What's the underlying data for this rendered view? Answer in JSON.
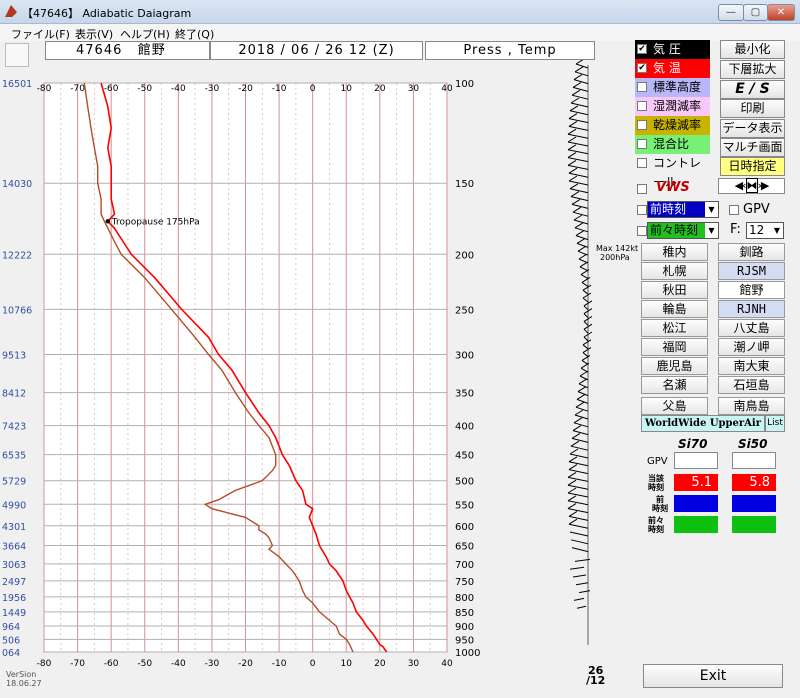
{
  "window": {
    "title": "【47646】 Adiabatic Daiagram",
    "min": "—",
    "max": "▢",
    "close": "✕"
  },
  "menu": [
    "ファイル(F)",
    "表示(V)",
    "ヘルプ(H)",
    "終了(Q)"
  ],
  "header": {
    "station_no": "47646",
    "station_name": "館野",
    "datetime": "2018 / 06 / 26  12 (Z)",
    "mode": "Press , Temp"
  },
  "checks": [
    {
      "label": "気 圧",
      "checked": true,
      "color": "#000000",
      "text": "#ffffff"
    },
    {
      "label": "気 温",
      "checked": true,
      "color": "#ff0000",
      "text": "#ffffff"
    },
    {
      "label": "標準高度",
      "checked": false,
      "color": "#b8b8f8",
      "text": "#000000"
    },
    {
      "label": "湿潤減率",
      "checked": false,
      "color": "#f8c8f8",
      "text": "#000000"
    },
    {
      "label": "乾燥減率",
      "checked": false,
      "color": "#c8b400",
      "text": "#000000"
    },
    {
      "label": "混合比",
      "checked": false,
      "color": "#78f078",
      "text": "#000000"
    },
    {
      "label": "コントレール",
      "checked": false,
      "color": "#f0f0f0",
      "text": "#000000"
    }
  ],
  "buttons": {
    "minimize": "最小化",
    "lower_zoom": "下層拡大",
    "es": "E / S",
    "print": "印刷",
    "data": "データ表示",
    "multi": "マルチ画面",
    "time": "日時指定"
  },
  "vws": "VWS",
  "prev": "前時刻",
  "prev2": "前々時刻",
  "gpv": "GPV",
  "f_label": "F:",
  "f_value": "12",
  "stations": [
    [
      "稚内",
      "釧路"
    ],
    [
      "札幌",
      "RJSM"
    ],
    [
      "秋田",
      "館野"
    ],
    [
      "輪島",
      "RJNH"
    ],
    [
      "松江",
      "八丈島"
    ],
    [
      "福岡",
      "潮ノ岬"
    ],
    [
      "鹿児島",
      "南大東"
    ],
    [
      "名瀬",
      "石垣島"
    ],
    [
      "父島",
      "南鳥島"
    ]
  ],
  "worldwide": "WorldWide UpperAir",
  "list": "List",
  "si": {
    "h70": "Si70",
    "h50": "Si50",
    "gpv": "GPV",
    "cur": "当該\n時刻",
    "cur_a": "当該",
    "cur_b": "時刻",
    "prev_a": "前",
    "prev_b": "時刻",
    "prev2_a": "前々",
    "prev2_b": "時刻",
    "v70": "5.1",
    "v50": "5.8"
  },
  "exit": "Exit",
  "version": {
    "a": "VerSion",
    "b": "18.06.27"
  },
  "barb_note": {
    "a": "Max 142kt",
    "b": "200hPa"
  },
  "barb_time": {
    "a": "26",
    "b": "/12"
  },
  "chart_data": {
    "type": "line",
    "title": "",
    "x_ticks": [
      -80,
      -70,
      -60,
      -50,
      -40,
      -30,
      -20,
      -10,
      0,
      10,
      20,
      30,
      40
    ],
    "xlim": [
      -80,
      40
    ],
    "pressure_ticks": [
      100,
      150,
      200,
      250,
      300,
      350,
      400,
      450,
      500,
      550,
      600,
      650,
      700,
      750,
      800,
      850,
      900,
      950,
      1000
    ],
    "height_ticks": [
      "16501",
      "14030",
      "12222",
      "10766",
      "9513",
      "8412",
      "7423",
      "6535",
      "5729",
      "4990",
      "4301",
      "3664",
      "3063",
      "2497",
      "1956",
      "1449",
      "964",
      "506",
      "064"
    ],
    "annotation": "Tropopause 175hPa",
    "annotation_point": {
      "p": 175,
      "t": -61
    },
    "series": [
      {
        "color": "#ff0000",
        "values": [
          [
            100,
            -63
          ],
          [
            110,
            -61
          ],
          [
            120,
            -60
          ],
          [
            130,
            -61
          ],
          [
            140,
            -60
          ],
          [
            150,
            -60
          ],
          [
            160,
            -60
          ],
          [
            170,
            -59
          ],
          [
            175,
            -61
          ],
          [
            180,
            -59
          ],
          [
            200,
            -54
          ],
          [
            220,
            -47
          ],
          [
            250,
            -39
          ],
          [
            280,
            -31
          ],
          [
            300,
            -28
          ],
          [
            320,
            -24
          ],
          [
            350,
            -20
          ],
          [
            380,
            -16
          ],
          [
            400,
            -13
          ],
          [
            420,
            -11
          ],
          [
            450,
            -9
          ],
          [
            470,
            -7
          ],
          [
            500,
            -5
          ],
          [
            520,
            -3
          ],
          [
            550,
            -2
          ],
          [
            560,
            0
          ],
          [
            580,
            -1
          ],
          [
            600,
            0
          ],
          [
            620,
            1
          ],
          [
            650,
            2
          ],
          [
            680,
            4
          ],
          [
            700,
            5
          ],
          [
            720,
            7
          ],
          [
            750,
            9
          ],
          [
            780,
            10
          ],
          [
            800,
            11
          ],
          [
            820,
            12
          ],
          [
            850,
            13
          ],
          [
            880,
            15
          ],
          [
            900,
            16
          ],
          [
            930,
            18
          ],
          [
            950,
            19
          ],
          [
            970,
            20
          ],
          [
            980,
            21
          ],
          [
            1000,
            22
          ]
        ]
      },
      {
        "color": "#b44c2a",
        "values": [
          [
            100,
            -68
          ],
          [
            110,
            -67
          ],
          [
            120,
            -66
          ],
          [
            130,
            -65
          ],
          [
            140,
            -64
          ],
          [
            150,
            -64
          ],
          [
            160,
            -63
          ],
          [
            170,
            -63
          ],
          [
            175,
            -62
          ],
          [
            190,
            -59
          ],
          [
            200,
            -57
          ],
          [
            220,
            -50
          ],
          [
            250,
            -42
          ],
          [
            280,
            -35
          ],
          [
            300,
            -31
          ],
          [
            320,
            -27
          ],
          [
            350,
            -23
          ],
          [
            380,
            -19
          ],
          [
            400,
            -16
          ],
          [
            420,
            -13
          ],
          [
            450,
            -11
          ],
          [
            470,
            -11
          ],
          [
            480,
            -12
          ],
          [
            500,
            -15
          ],
          [
            520,
            -23
          ],
          [
            540,
            -28
          ],
          [
            550,
            -32
          ],
          [
            560,
            -30
          ],
          [
            570,
            -25
          ],
          [
            580,
            -20
          ],
          [
            600,
            -16
          ],
          [
            610,
            -16
          ],
          [
            620,
            -14
          ],
          [
            630,
            -13
          ],
          [
            650,
            -12
          ],
          [
            660,
            -13
          ],
          [
            680,
            -10
          ],
          [
            700,
            -8
          ],
          [
            720,
            -6
          ],
          [
            750,
            -4
          ],
          [
            780,
            -3
          ],
          [
            800,
            -2
          ],
          [
            820,
            0
          ],
          [
            850,
            2
          ],
          [
            880,
            5
          ],
          [
            900,
            7
          ],
          [
            930,
            8
          ],
          [
            950,
            10
          ],
          [
            970,
            11
          ],
          [
            1000,
            12
          ]
        ]
      }
    ]
  }
}
